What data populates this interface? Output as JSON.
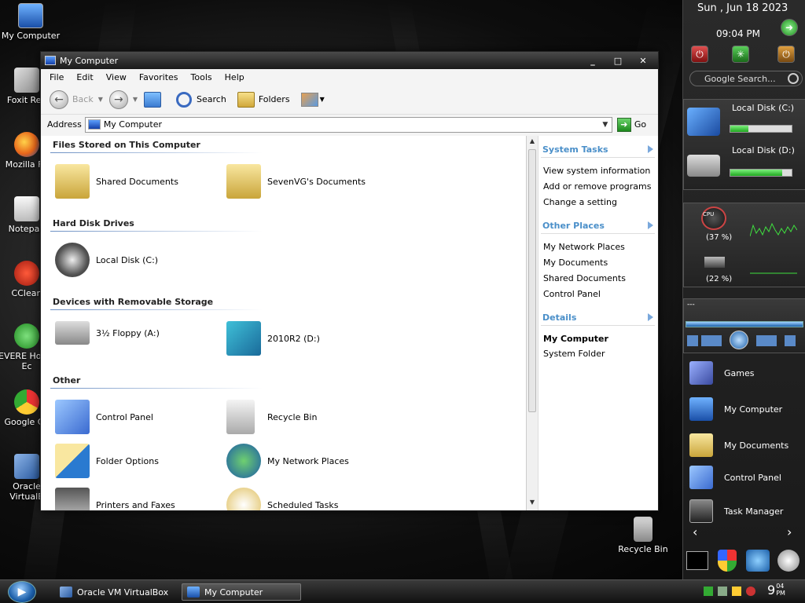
{
  "desktop_icons": [
    {
      "label": "My Computer"
    },
    {
      "label": "Foxit Rea"
    },
    {
      "label": "Mozilla Fir"
    },
    {
      "label": "Notepad"
    },
    {
      "label": "CClean"
    },
    {
      "label": "EVERE Home Ec"
    },
    {
      "label": "Google Ch"
    },
    {
      "label": "Oracle VirtualB"
    },
    {
      "label": "Recycle Bin"
    }
  ],
  "window": {
    "title": "My Computer",
    "min": "_",
    "max": "□",
    "close": "✕"
  },
  "menu": [
    "File",
    "Edit",
    "View",
    "Favorites",
    "Tools",
    "Help"
  ],
  "toolbar": {
    "back_label": "Back",
    "search_label": "Search",
    "folders_label": "Folders"
  },
  "address": {
    "label": "Address",
    "value": "My Computer",
    "go_label": "Go"
  },
  "sections": [
    {
      "title": "Files Stored on This Computer",
      "items": [
        "Shared Documents",
        "SevenVG's Documents"
      ]
    },
    {
      "title": "Hard Disk Drives",
      "items": [
        "Local Disk (C:)"
      ]
    },
    {
      "title": "Devices with Removable Storage",
      "items": [
        "3½ Floppy (A:)",
        "2010R2 (D:)"
      ]
    },
    {
      "title": "Other",
      "items": [
        "Control Panel",
        "Recycle Bin",
        "Folder Options",
        "My Network Places",
        "Printers and Faxes",
        "Scheduled Tasks"
      ]
    }
  ],
  "side_pane": {
    "system_tasks": {
      "title": "System Tasks",
      "links": [
        "View system information",
        "Add or remove programs",
        "Change a setting"
      ]
    },
    "other_places": {
      "title": "Other Places",
      "links": [
        "My Network Places",
        "My Documents",
        "Shared Documents",
        "Control Panel"
      ]
    },
    "details": {
      "title": "Details",
      "name": "My Computer",
      "type": "System Folder"
    }
  },
  "right_sidebar": {
    "date": "Sun , Jun 18 2023",
    "time": "09:04 PM",
    "search_placeholder": "Google Search...",
    "disk_c_label": "Local Disk (C:)",
    "disk_d_label": "Local Disk (D:)",
    "disk_c_usage": 0.3,
    "disk_d_usage": 0.85,
    "cpu_label": "CPU",
    "cpu_percent": "(37 %)",
    "ram_percent": "(22 %)",
    "media_text": "---",
    "launcher": [
      "Games",
      "My Computer",
      "My Documents",
      "Control Panel",
      "Task Manager"
    ],
    "scroll_left": "‹",
    "scroll_right": "›"
  },
  "taskbar": {
    "tasks": [
      "Oracle VM VirtualBox",
      "My Computer"
    ],
    "clock": "9",
    "clock_small": "04 PM"
  },
  "colors": {
    "accent": "#4a8fc9",
    "window_bg": "#f4f4f4",
    "green": "#2fb82f"
  }
}
